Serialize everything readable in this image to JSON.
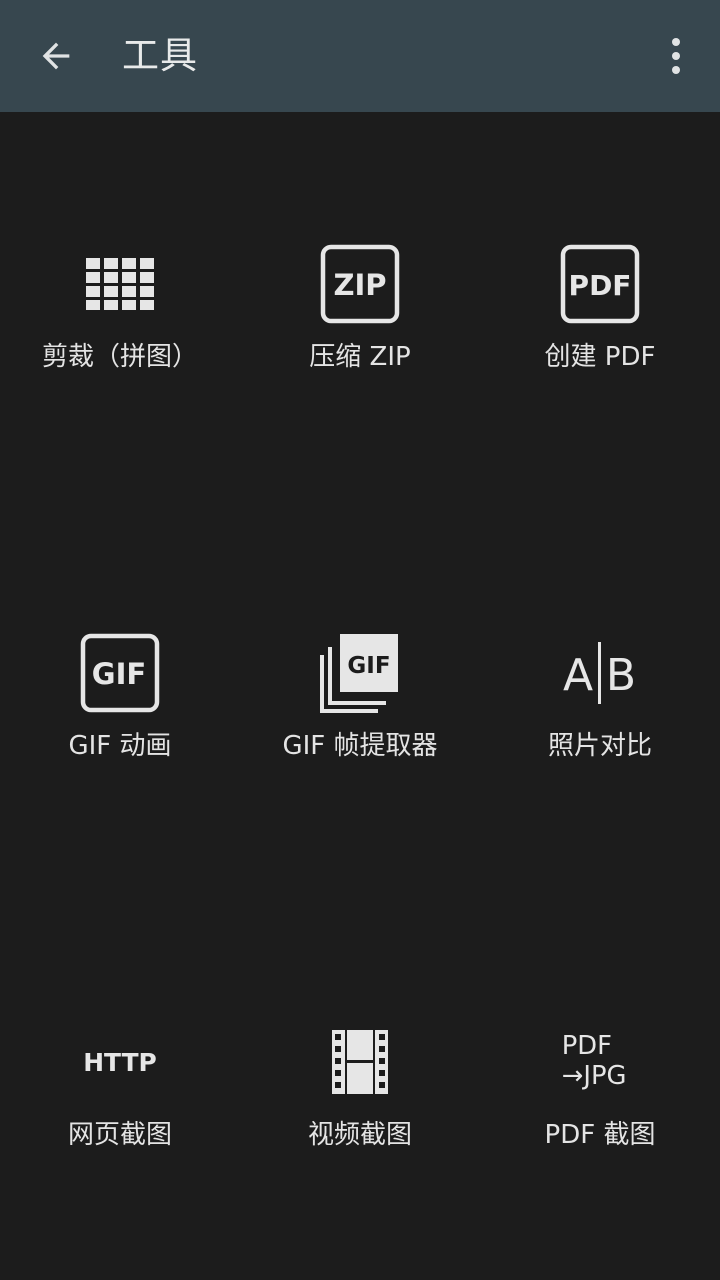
{
  "appbar": {
    "title": "工具",
    "back_icon": "arrow-back-icon",
    "menu_icon": "more-vert-icon",
    "background": "#37474f"
  },
  "tools": [
    {
      "label": "剪裁（拼图）",
      "icon": "grid-icon"
    },
    {
      "label": "压缩 ZIP",
      "icon": "zip-icon",
      "icon_text": "ZIP"
    },
    {
      "label": "创建 PDF",
      "icon": "pdf-icon",
      "icon_text": "PDF"
    },
    {
      "label": "GIF 动画",
      "icon": "gif-icon",
      "icon_text": "GIF"
    },
    {
      "label": "GIF 帧提取器",
      "icon": "gif-frames-icon",
      "icon_text": "GIF"
    },
    {
      "label": "照片对比",
      "icon": "ab-compare-icon",
      "icon_text_a": "A",
      "icon_text_b": "B"
    },
    {
      "label": "网页截图",
      "icon": "http-icon",
      "icon_text": "HTTP"
    },
    {
      "label": "视频截图",
      "icon": "film-icon"
    },
    {
      "label": "PDF 截图",
      "icon": "pdf-to-jpg-icon",
      "icon_text_top": "PDF",
      "icon_text_bottom": "→JPG"
    }
  ],
  "colors": {
    "background": "#1c1c1c",
    "icon": "#e6e6e6"
  }
}
